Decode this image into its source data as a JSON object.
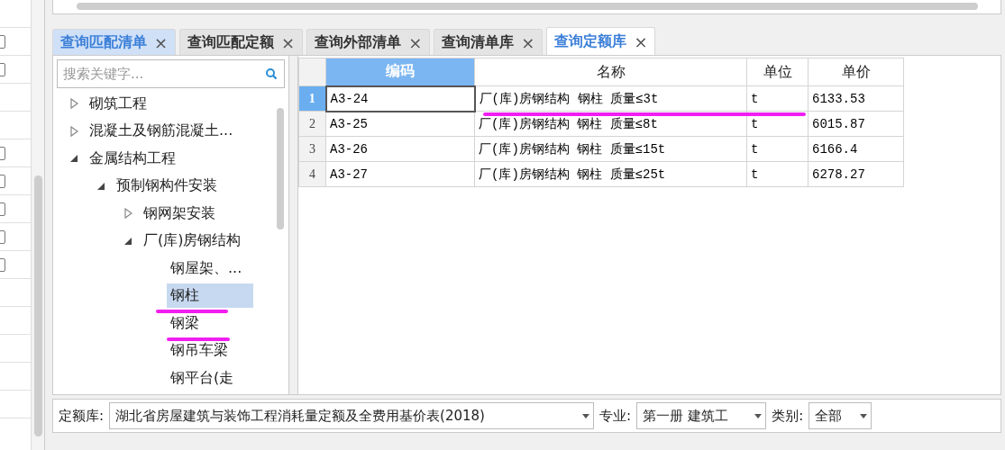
{
  "tabs": [
    {
      "label": "查询匹配清单",
      "close": "×",
      "selected": false,
      "hovered": true
    },
    {
      "label": "查询匹配定额",
      "close": "×",
      "selected": false,
      "hovered": false
    },
    {
      "label": "查询外部清单",
      "close": "×",
      "selected": false,
      "hovered": false
    },
    {
      "label": "查询清单库",
      "close": "×",
      "selected": false,
      "hovered": false
    },
    {
      "label": "查询定额库",
      "close": "×",
      "selected": true,
      "hovered": false
    }
  ],
  "search": {
    "placeholder": "搜索关键字..."
  },
  "tree": [
    {
      "label": "砌筑工程",
      "expanded": false,
      "selected": false
    },
    {
      "label": "混凝土及钢筋混凝土...",
      "expanded": false,
      "selected": false
    },
    {
      "label": "金属结构工程",
      "expanded": true,
      "selected": false,
      "children": [
        {
          "label": "预制钢构件安装",
          "expanded": true,
          "selected": false,
          "children": [
            {
              "label": "钢网架安装",
              "expanded": false,
              "selected": false
            },
            {
              "label": "厂(库)房钢结构",
              "expanded": true,
              "selected": false,
              "children": [
                {
                  "label": "钢屋架、...",
                  "selected": false
                },
                {
                  "label": "钢柱",
                  "selected": true,
                  "underlined": true
                },
                {
                  "label": "钢梁",
                  "selected": false,
                  "underlined": true
                },
                {
                  "label": "钢吊车梁",
                  "selected": false
                },
                {
                  "label": "钢平台(走",
                  "selected": false
                }
              ]
            }
          ]
        }
      ]
    }
  ],
  "table": {
    "columns": [
      {
        "label": "编码",
        "selected": true
      },
      {
        "label": "名称",
        "selected": false
      },
      {
        "label": "单位",
        "selected": false
      },
      {
        "label": "单价",
        "selected": false
      }
    ],
    "rows": [
      {
        "index": "1",
        "selected": true,
        "underlined": true,
        "cells": [
          "A3-24",
          "厂(库)房钢结构 钢柱 质量≤3t",
          "t",
          "6133.53"
        ]
      },
      {
        "index": "2",
        "selected": false,
        "underlined": false,
        "cells": [
          "A3-25",
          "厂(库)房钢结构 钢柱 质量≤8t",
          "t",
          "6015.87"
        ]
      },
      {
        "index": "3",
        "selected": false,
        "underlined": false,
        "cells": [
          "A3-26",
          "厂(库)房钢结构 钢柱 质量≤15t",
          "t",
          "6166.4"
        ]
      },
      {
        "index": "4",
        "selected": false,
        "underlined": false,
        "cells": [
          "A3-27",
          "厂(库)房钢结构 钢柱 质量≤25t",
          "t",
          "6278.27"
        ]
      }
    ]
  },
  "filters": [
    {
      "label": "定额库:",
      "value": "湖北省房屋建筑与装饰工程消耗量定额及全费用基价表(2018)"
    },
    {
      "label": "专业:",
      "value": "第一册 建筑工"
    },
    {
      "label": "类别:",
      "value": "全部"
    }
  ]
}
